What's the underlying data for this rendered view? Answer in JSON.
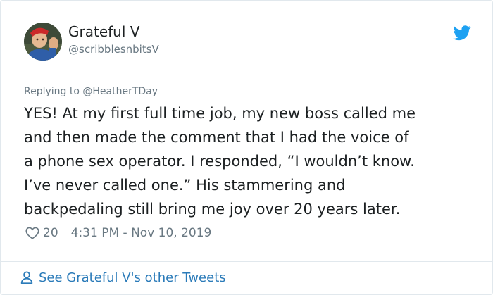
{
  "author": {
    "name": "Grateful V",
    "handle": "@scribblesnbitsV"
  },
  "tweet": {
    "reply_prefix": "Replying to ",
    "reply_handle": "@HeatherTDay",
    "text_lines": [
      "YES! At my first full time job, my new boss called me",
      "and then made the comment that I had the voice of",
      "a phone sex operator. I responded, “I wouldn’t know.",
      "I’ve never called one.” His stammering and",
      "backpedaling still bring me joy over 20 years later."
    ],
    "likes": "20",
    "timestamp": "4:31 PM - Nov 10, 2019"
  },
  "footer": {
    "link_label": "See Grateful V's other Tweets"
  },
  "icons": {
    "brand": "twitter-bird-icon",
    "like": "heart-icon",
    "profile": "person-icon"
  },
  "colors": {
    "brand_blue": "#1da1f2",
    "link_blue": "#2b7bb9",
    "muted_text": "#697882",
    "border": "#e1e8ed"
  }
}
